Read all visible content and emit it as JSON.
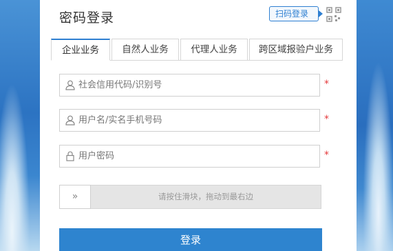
{
  "login": {
    "title": "密码登录",
    "scan_button": "扫码登录",
    "tabs": [
      {
        "label": "企业业务",
        "active": true
      },
      {
        "label": "自然人业务",
        "active": false
      },
      {
        "label": "代理人业务",
        "active": false
      },
      {
        "label": "跨区域报验户业务",
        "active": false
      }
    ],
    "fields": [
      {
        "placeholder": "社会信用代码/识别号",
        "value": "",
        "icon": "user-icon",
        "required": "*"
      },
      {
        "placeholder": "用户名/实名手机号码",
        "value": "",
        "icon": "user-icon",
        "required": "*"
      },
      {
        "placeholder": "用户密码",
        "value": "",
        "icon": "lock-icon",
        "required": "*"
      }
    ],
    "slider": {
      "handle_label": "»",
      "text": "请按住滑块，拖动到最右边",
      "progress": 0
    },
    "submit_label": "登录"
  },
  "colors": {
    "accent": "#2e7fd1",
    "button": "#2e84cf",
    "required": "#e4393c",
    "slider_track": "#e5e5e5"
  }
}
